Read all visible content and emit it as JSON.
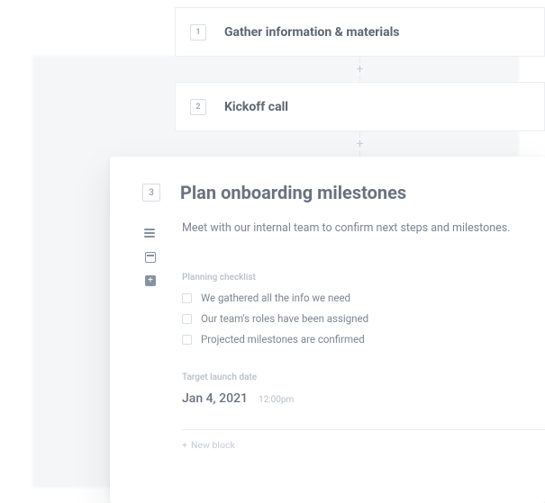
{
  "steps": [
    {
      "num": "1",
      "title": "Gather information & materials"
    },
    {
      "num": "2",
      "title": "Kickoff call"
    },
    {
      "num": "3",
      "title": "Plan onboarding milestones"
    }
  ],
  "detail": {
    "description": "Meet with our internal team to confirm next steps and milestones.",
    "checklist": {
      "label": "Planning checklist",
      "items": [
        "We gathered all the info we need",
        "Our team's roles have been assigned",
        "Projected milestones are confirmed"
      ]
    },
    "target": {
      "label": "Target launch date",
      "date": "Jan 4, 2021",
      "time": "12:00pm"
    },
    "new_block_label": "New block"
  },
  "icons": {
    "text": "text-lines-icon",
    "date": "calendar-icon",
    "add": "add-block-icon"
  },
  "glyphs": {
    "plus": "+"
  }
}
